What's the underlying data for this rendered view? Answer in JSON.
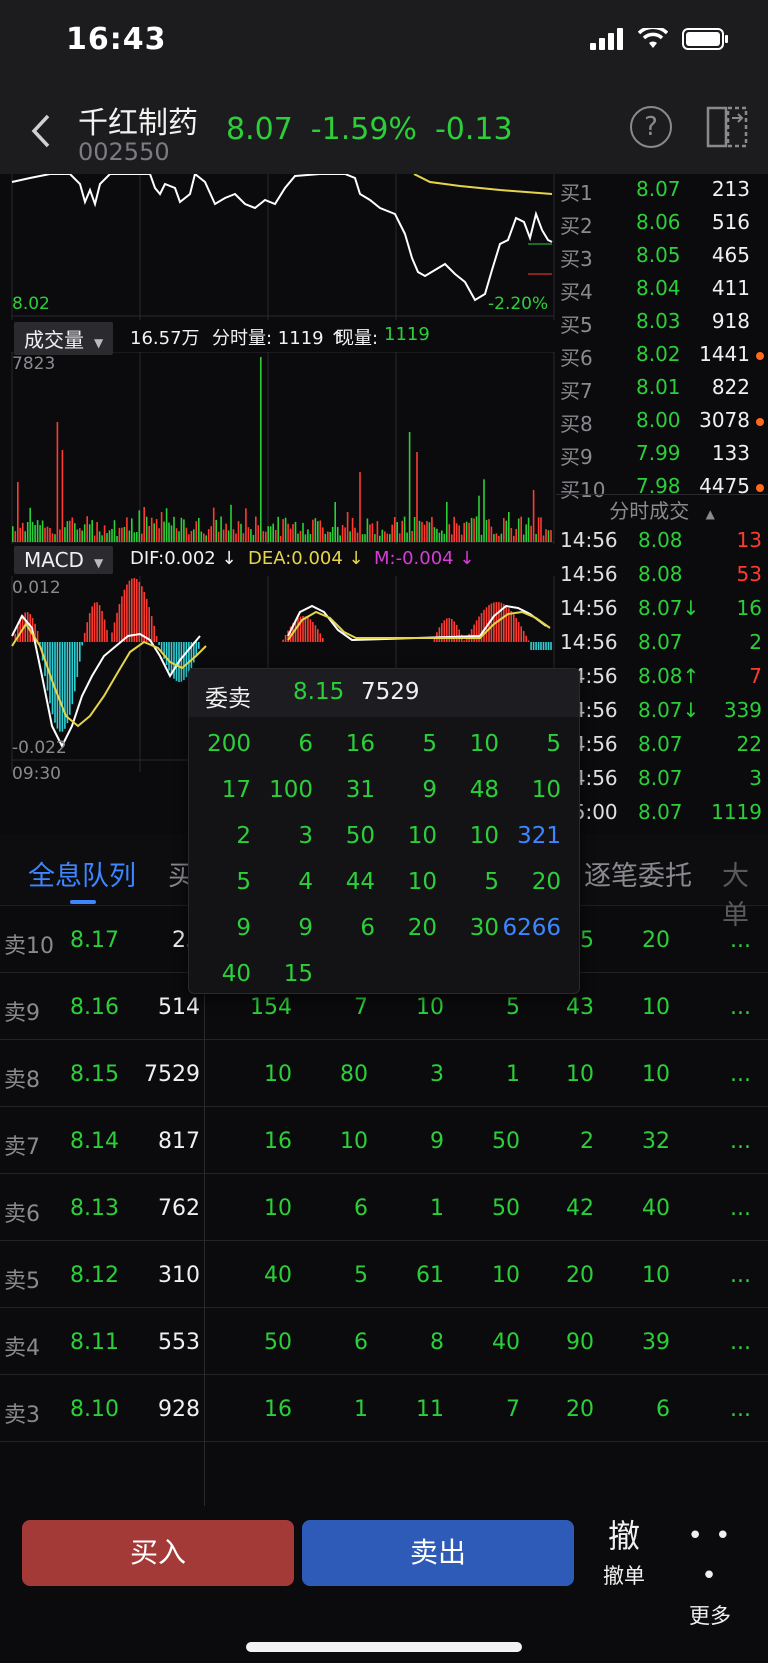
{
  "status_bar": {
    "time": "16:43"
  },
  "header": {
    "stock_name": "千红制药",
    "stock_code": "002550",
    "price": "8.07",
    "change_pct": "-1.59%",
    "change": "-0.13",
    "help_label": "?"
  },
  "price_chart": {
    "low_price_label": "8.02",
    "low_pct_label": "-2.20%"
  },
  "volume_chart": {
    "tab_label": "成交量",
    "total_volume": "16.57万",
    "tick_volume_label": "分时量: 1119 ↑",
    "current_label": "现量:",
    "current_value": "1119",
    "max_label": "7823"
  },
  "macd_chart": {
    "tab_label": "MACD",
    "dif": "DIF:0.002 ↓",
    "dea": "DEA:0.004 ↓",
    "m": "M:-0.004 ↓",
    "top_label": "0.012",
    "bottom_label": "-0.022",
    "time_label": "09:30"
  },
  "order_book": [
    {
      "label": "买1",
      "price": "8.07",
      "vol": "213",
      "dot": false
    },
    {
      "label": "买2",
      "price": "8.06",
      "vol": "516",
      "dot": false
    },
    {
      "label": "买3",
      "price": "8.05",
      "vol": "465",
      "dot": false
    },
    {
      "label": "买4",
      "price": "8.04",
      "vol": "411",
      "dot": false
    },
    {
      "label": "买5",
      "price": "8.03",
      "vol": "918",
      "dot": false
    },
    {
      "label": "买6",
      "price": "8.02",
      "vol": "1441",
      "dot": true
    },
    {
      "label": "买7",
      "price": "8.01",
      "vol": "822",
      "dot": false
    },
    {
      "label": "买8",
      "price": "8.00",
      "vol": "3078",
      "dot": true
    },
    {
      "label": "买9",
      "price": "7.99",
      "vol": "133",
      "dot": false
    },
    {
      "label": "买10",
      "price": "7.98",
      "vol": "4475",
      "dot": true
    }
  ],
  "trades_title": "分时成交",
  "trades": [
    {
      "time": "14:56",
      "price": "8.08",
      "vol": "13",
      "vol_color": "red"
    },
    {
      "time": "14:56",
      "price": "8.08",
      "vol": "53",
      "vol_color": "red"
    },
    {
      "time": "14:56",
      "price": "8.07↓",
      "vol": "16",
      "vol_color": "green"
    },
    {
      "time": "14:56",
      "price": "8.07",
      "vol": "2",
      "vol_color": "green"
    },
    {
      "time": "14:56",
      "price": "8.08↑",
      "vol": "7",
      "vol_color": "red"
    },
    {
      "time": "14:56",
      "price": "8.07↓",
      "vol": "339",
      "vol_color": "green"
    },
    {
      "time": "14:56",
      "price": "8.07",
      "vol": "22",
      "vol_color": "green"
    },
    {
      "time": "14:56",
      "price": "8.07",
      "vol": "3",
      "vol_color": "green"
    },
    {
      "time": "15:00",
      "price": "8.07",
      "vol": "1119",
      "vol_color": "green"
    }
  ],
  "tabs": {
    "queue": "全息队列",
    "buy_partial": "买",
    "by_order": "逐笔委托",
    "big_partial": "大单"
  },
  "queue": [
    {
      "label": "卖10",
      "price": "8.17",
      "total": "23",
      "cells": [
        "",
        "",
        "",
        "",
        "5",
        "20"
      ]
    },
    {
      "label": "卖9",
      "price": "8.16",
      "total": "514",
      "cells": [
        "154",
        "7",
        "10",
        "5",
        "43",
        "10"
      ]
    },
    {
      "label": "卖8",
      "price": "8.15",
      "total": "7529",
      "cells": [
        "10",
        "80",
        "3",
        "1",
        "10",
        "10"
      ]
    },
    {
      "label": "卖7",
      "price": "8.14",
      "total": "817",
      "cells": [
        "16",
        "10",
        "9",
        "50",
        "2",
        "32"
      ]
    },
    {
      "label": "卖6",
      "price": "8.13",
      "total": "762",
      "cells": [
        "10",
        "6",
        "1",
        "50",
        "42",
        "40"
      ]
    },
    {
      "label": "卖5",
      "price": "8.12",
      "total": "310",
      "cells": [
        "40",
        "5",
        "61",
        "10",
        "20",
        "10"
      ]
    },
    {
      "label": "卖4",
      "price": "8.11",
      "total": "553",
      "cells": [
        "50",
        "6",
        "8",
        "40",
        "90",
        "39"
      ]
    },
    {
      "label": "卖3",
      "price": "8.10",
      "total": "928",
      "cells": [
        "16",
        "1",
        "11",
        "7",
        "20",
        "6"
      ]
    }
  ],
  "queue_more": "...",
  "popup": {
    "title": "委卖",
    "price": "8.15",
    "total": "7529",
    "rows": [
      [
        "200",
        "6",
        "16",
        "5",
        "10",
        "5"
      ],
      [
        "17",
        "100",
        "31",
        "9",
        "48",
        "10"
      ],
      [
        "2",
        "3",
        "50",
        "10",
        "10",
        "321"
      ],
      [
        "5",
        "4",
        "44",
        "10",
        "5",
        "20"
      ],
      [
        "9",
        "9",
        "6",
        "20",
        "30",
        "6266"
      ],
      [
        "40",
        "15",
        "",
        "",
        "",
        ""
      ]
    ],
    "highlight": [
      "321",
      "6266"
    ]
  },
  "bottom": {
    "buy": "买入",
    "sell": "卖出",
    "cancel_icon": "撤",
    "cancel": "撤单",
    "more": "更多"
  }
}
